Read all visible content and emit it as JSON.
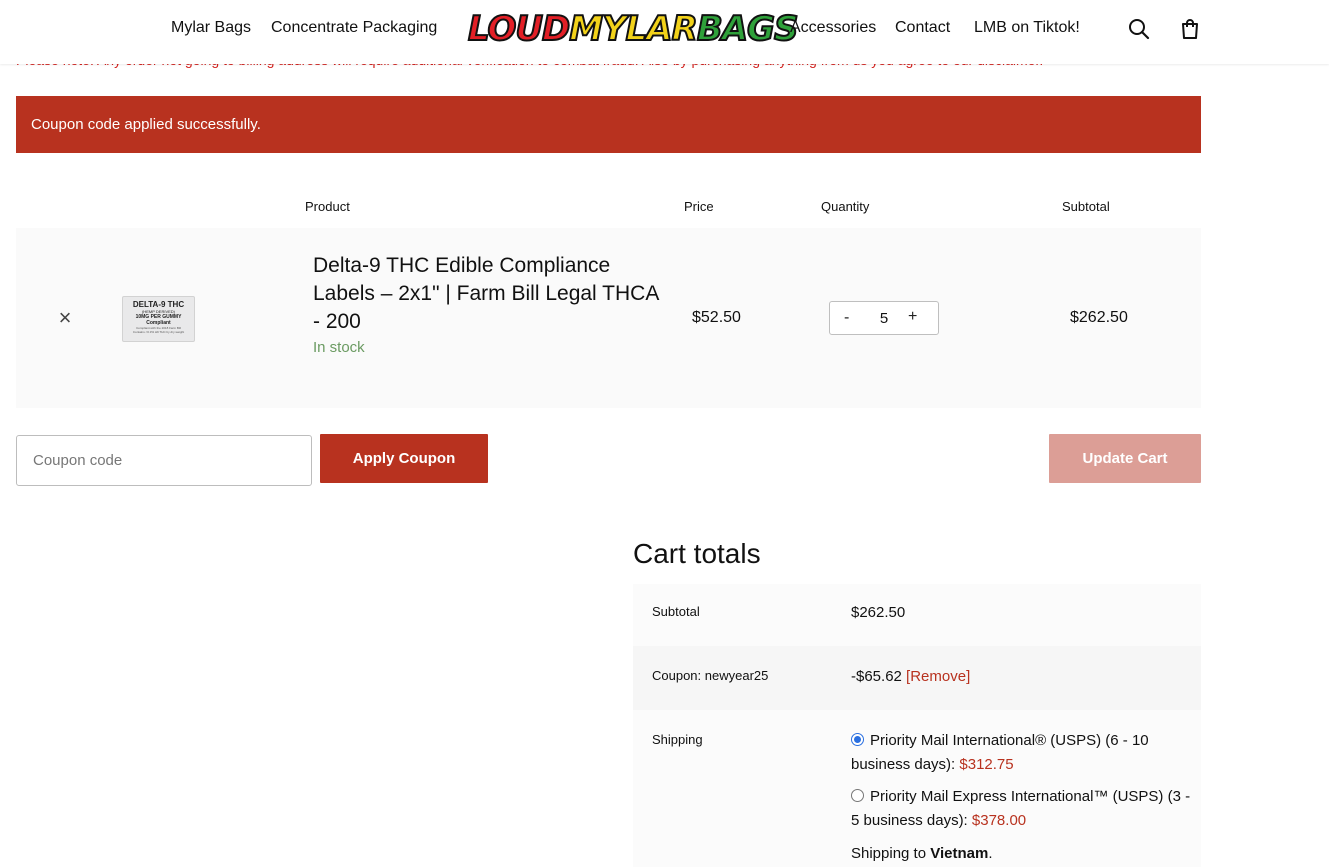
{
  "header": {
    "nav_left": [
      "Mylar Bags",
      "Concentrate Packaging"
    ],
    "logo_text": {
      "part1": "LOUD",
      "part2": "MYLAR",
      "part3": "BAGS"
    },
    "nav_right": [
      "Accessories",
      "Contact",
      "LMB on Tiktok!"
    ],
    "icons": {
      "search": "search-icon",
      "cart": "shopping-bag-icon"
    }
  },
  "notice": "Please note: Any order not going to billing address will require additional verification to combat fraud. Also by purchasing anything from us you agree to our disclaimer.",
  "banner": {
    "message": "Coupon code applied successfully."
  },
  "cart_table": {
    "headers": {
      "product": "Product",
      "price": "Price",
      "quantity": "Quantity",
      "subtotal": "Subtotal"
    },
    "item": {
      "remove_glyph": "×",
      "thumb": {
        "line1": "DELTA-9 THC",
        "line2": "(HEMP DERIVED)",
        "line3": "10MG PER GUMMY",
        "line4": "Compliant",
        "line5": "Compliant with the 2018 Farm Bill",
        "line6": "Contains <0.3% Δ9 THC by dry weight"
      },
      "name": "Delta-9 THC Edible Compliance Labels – 2x1\" | Farm Bill Legal THCA - 200",
      "stock": "In stock",
      "price": "$52.50",
      "qty_minus": "-",
      "quantity": "5",
      "qty_plus": "+",
      "subtotal": "$262.50"
    }
  },
  "coupon": {
    "placeholder": "Coupon code",
    "apply_label": "Apply Coupon",
    "update_label": "Update Cart"
  },
  "totals": {
    "title": "Cart totals",
    "subtotal_label": "Subtotal",
    "subtotal_value": "$262.50",
    "coupon_label": "Coupon: newyear25",
    "coupon_value": "-$65.62",
    "coupon_remove": "[Remove]",
    "shipping_label": "Shipping",
    "shipping_options": [
      {
        "label": "Priority Mail International® (USPS) (6 - 10 business days): ",
        "price": "$312.75",
        "selected": true
      },
      {
        "label": "Priority Mail Express International™ (USPS) (3 - 5 business days): ",
        "price": "$378.00",
        "selected": false
      }
    ],
    "ship_to_prefix": "Shipping to ",
    "ship_to_country": "Vietnam",
    "ship_to_suffix": "."
  },
  "colors": {
    "accent": "#b8321f",
    "accent_disabled": "#dc9e96",
    "stock_green": "#6b9b62",
    "notice_red": "#d4231f",
    "radio_blue": "#2a6fe0"
  }
}
